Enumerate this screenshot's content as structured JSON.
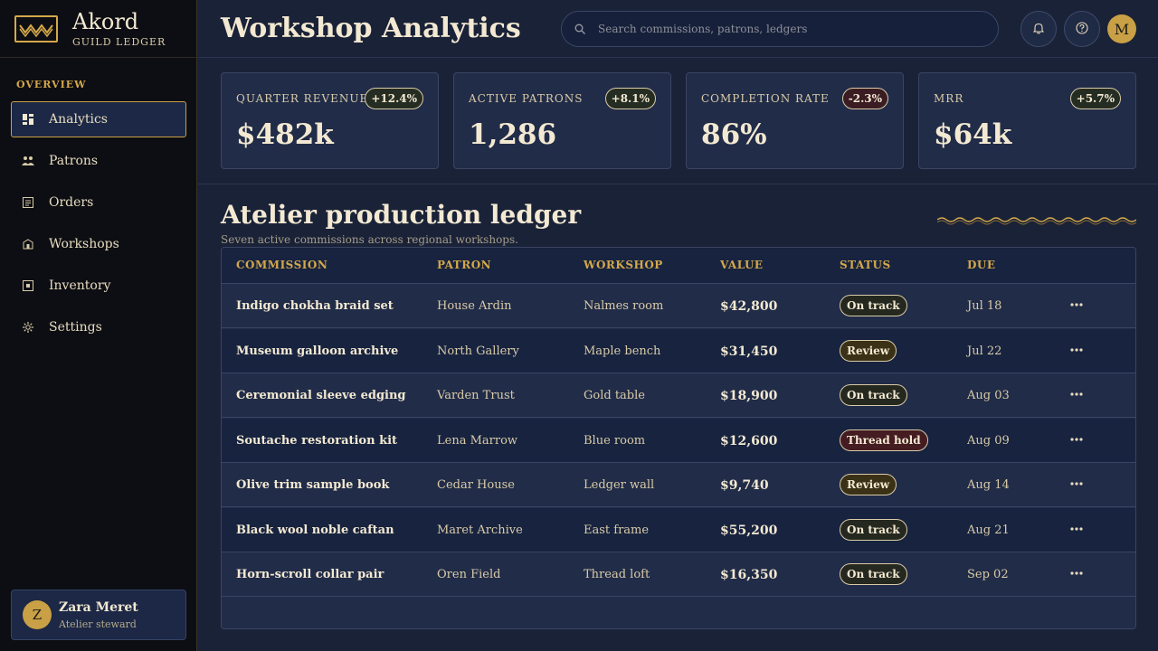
{
  "brand": {
    "name": "Akord",
    "subtitle": "GUILD LEDGER"
  },
  "sidebar": {
    "section": "OVERVIEW",
    "items": [
      {
        "label": "Analytics",
        "icon": "chart-icon",
        "active": true
      },
      {
        "label": "Patrons",
        "icon": "users-icon"
      },
      {
        "label": "Orders",
        "icon": "receipt-icon"
      },
      {
        "label": "Workshops",
        "icon": "building-icon"
      },
      {
        "label": "Inventory",
        "icon": "box-icon"
      },
      {
        "label": "Settings",
        "icon": "gear-icon"
      }
    ],
    "user": {
      "initial": "Z",
      "name": "Zara Meret",
      "role": "Atelier steward"
    }
  },
  "header": {
    "title": "Workshop Analytics",
    "search_placeholder": "Search commissions, patrons, ledgers",
    "avatar_initial": "M"
  },
  "kpis": [
    {
      "label": "QUARTER REVENUE",
      "value": "$482k",
      "delta": "+12.4%",
      "trend": "up"
    },
    {
      "label": "ACTIVE PATRONS",
      "value": "1,286",
      "delta": "+8.1%",
      "trend": "up"
    },
    {
      "label": "COMPLETION RATE",
      "value": "86%",
      "delta": "-2.3%",
      "trend": "down"
    },
    {
      "label": "MRR",
      "value": "$64k",
      "delta": "+5.7%",
      "trend": "up"
    }
  ],
  "ledger": {
    "title": "Atelier production ledger",
    "subtitle": "Seven active commissions across regional workshops.",
    "columns": [
      "COMMISSION",
      "PATRON",
      "WORKSHOP",
      "VALUE",
      "STATUS",
      "DUE"
    ],
    "rows": [
      {
        "commission": "Indigo chokha braid set",
        "patron": "House Ardin",
        "workshop": "Nalmes room",
        "value": "$42,800",
        "status": "On track",
        "due": "Jul 18"
      },
      {
        "commission": "Museum galloon archive",
        "patron": "North Gallery",
        "workshop": "Maple bench",
        "value": "$31,450",
        "status": "Review",
        "due": "Jul 22"
      },
      {
        "commission": "Ceremonial sleeve edging",
        "patron": "Varden Trust",
        "workshop": "Gold table",
        "value": "$18,900",
        "status": "On track",
        "due": "Aug 03"
      },
      {
        "commission": "Soutache restoration kit",
        "patron": "Lena Marrow",
        "workshop": "Blue room",
        "value": "$12,600",
        "status": "Thread hold",
        "due": "Aug 09"
      },
      {
        "commission": "Olive trim sample book",
        "patron": "Cedar House",
        "workshop": "Ledger wall",
        "value": "$9,740",
        "status": "Review",
        "due": "Aug 14"
      },
      {
        "commission": "Black wool noble caftan",
        "patron": "Maret Archive",
        "workshop": "East frame",
        "value": "$55,200",
        "status": "On track",
        "due": "Aug 21"
      },
      {
        "commission": "Horn-scroll collar pair",
        "patron": "Oren Field",
        "workshop": "Thread loft",
        "value": "$16,350",
        "status": "On track",
        "due": "Sep 02"
      }
    ]
  },
  "colors": {
    "accent": "#d4a84a",
    "background": "#1a2238",
    "sidebar": "#0d0e13"
  }
}
